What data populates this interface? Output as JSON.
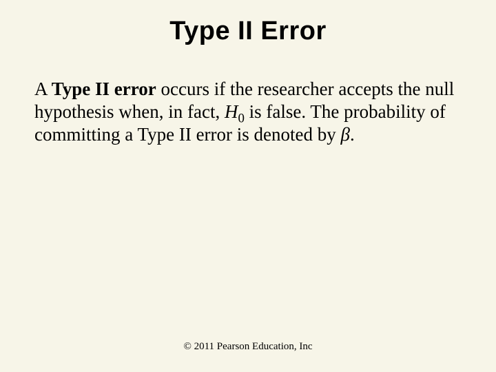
{
  "title": "Type II Error",
  "body": {
    "t1": "A ",
    "bold": "Type II error",
    "t2": " occurs if the researcher accepts the null hypothesis when, in fact, ",
    "h": "H",
    "sub0": "0",
    "t3": " is false. The probability of committing a Type II error is denoted by ",
    "beta": "β",
    "t4": "."
  },
  "footer": "© 2011 Pearson Education, Inc"
}
